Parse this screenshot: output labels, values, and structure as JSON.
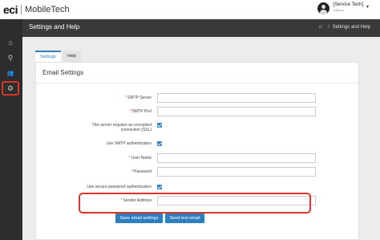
{
  "brand": {
    "logo": "eci",
    "app_name": "MobileTech"
  },
  "user": {
    "name": "[Service Tech]",
    "subtitle": "Sajmon",
    "caret": "▾"
  },
  "sidebar": {
    "items": [
      {
        "icon": "home-icon",
        "glyph": "⌂"
      },
      {
        "icon": "map-marker-icon",
        "glyph": "⚲"
      },
      {
        "icon": "users-icon",
        "glyph": "👥"
      },
      {
        "icon": "gear-icon",
        "glyph": "⚙"
      }
    ]
  },
  "header": {
    "title": "Settings and Help",
    "breadcrumb": {
      "home_glyph": "⌂",
      "separator": "/",
      "current": "Settings and Help"
    }
  },
  "tabs": [
    {
      "label": "Settings",
      "active": true
    },
    {
      "label": "Help",
      "active": false
    }
  ],
  "panel": {
    "title": "Email Settings",
    "fields": {
      "smtp_server": {
        "label": "SMTP Server",
        "required": true,
        "value": ""
      },
      "smtp_port": {
        "label": "SMTP Port",
        "required": true,
        "value": ""
      },
      "ssl": {
        "label": "This server requires an encrypted connection (SSL)",
        "checked": true
      },
      "smtp_auth": {
        "label": "Use SMTP authentication",
        "checked": true
      },
      "user_name": {
        "label": "User Name",
        "required": true,
        "value": ""
      },
      "password": {
        "label": "Password",
        "required": true,
        "value": ""
      },
      "secure_password": {
        "label": "Use secure password authentication",
        "checked": true
      },
      "sender_address": {
        "label": "Sender Address",
        "required": true,
        "value": ""
      }
    },
    "required_marker": "*",
    "buttons": {
      "save": "Save email settings",
      "test": "Send test email"
    }
  },
  "colors": {
    "accent": "#2e7fbf",
    "highlight": "#d9352a",
    "sidebar": "#2d2d2d",
    "header": "#3a3a3a"
  }
}
